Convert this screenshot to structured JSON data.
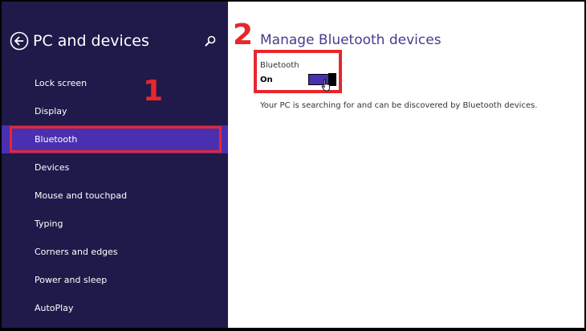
{
  "sidebar": {
    "title": "PC and devices",
    "back_icon": "back-arrow-circle-icon",
    "search_icon": "search-icon",
    "items": [
      {
        "label": "Lock screen",
        "selected": false
      },
      {
        "label": "Display",
        "selected": false
      },
      {
        "label": "Bluetooth",
        "selected": true
      },
      {
        "label": "Devices",
        "selected": false
      },
      {
        "label": "Mouse and touchpad",
        "selected": false
      },
      {
        "label": "Typing",
        "selected": false
      },
      {
        "label": "Corners and edges",
        "selected": false
      },
      {
        "label": "Power and sleep",
        "selected": false
      },
      {
        "label": "AutoPlay",
        "selected": false
      }
    ]
  },
  "annotations": {
    "step_1": "1",
    "step_2": "2",
    "highlight_color": "#e8262c"
  },
  "main": {
    "title": "Manage Bluetooth devices",
    "bluetooth_toggle": {
      "label": "Bluetooth",
      "state_text": "On",
      "is_on": true
    },
    "status_text": "Your PC is searching for and can be discovered by Bluetooth devices.",
    "cursor_icon": "pointer-hand-icon"
  },
  "colors": {
    "sidebar_bg": "#1f1a4a",
    "selected_bg": "#4a2fb0",
    "title_color": "#4a3a8e",
    "toggle_on": "#4a2fb0"
  }
}
